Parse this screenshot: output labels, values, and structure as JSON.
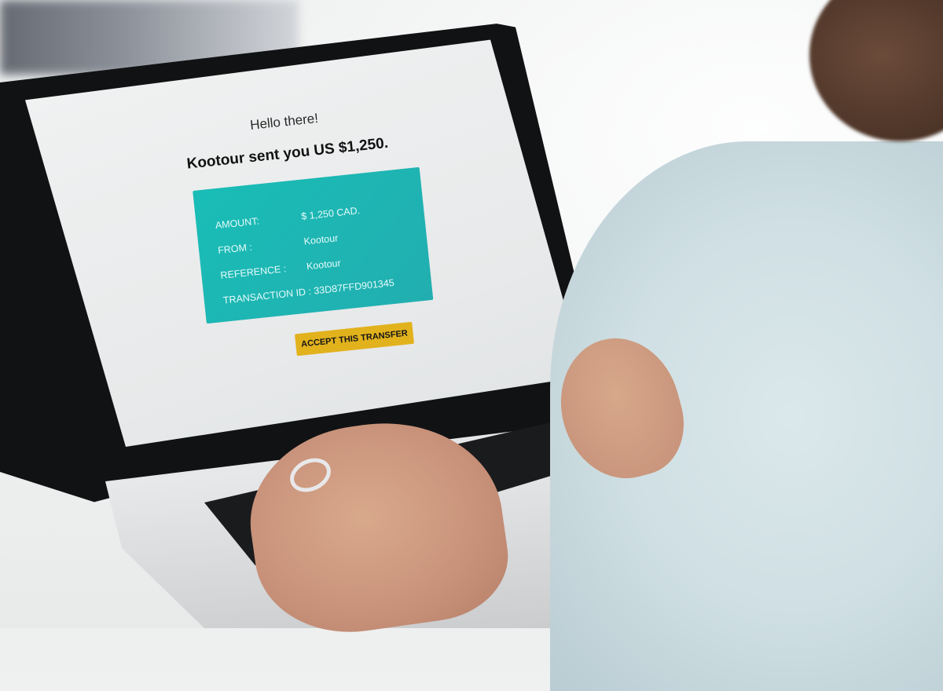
{
  "screen": {
    "greeting": "Hello there!",
    "headline": "Kootour sent you US $1,250.",
    "transfer": {
      "amount_label": "AMOUNT:",
      "amount_value": "$ 1,250 CAD.",
      "from_label": "FROM :",
      "from_value": "Kootour",
      "reference_label": "REFERENCE :",
      "reference_value": "Kootour",
      "transaction_label": "TRANSACTION ID :",
      "transaction_value": "33D87FFD901345"
    },
    "accept_button_label": "ACCEPT THIS TRANSFER",
    "card_color": "#1fb6b3",
    "button_color": "#e2b21d"
  }
}
